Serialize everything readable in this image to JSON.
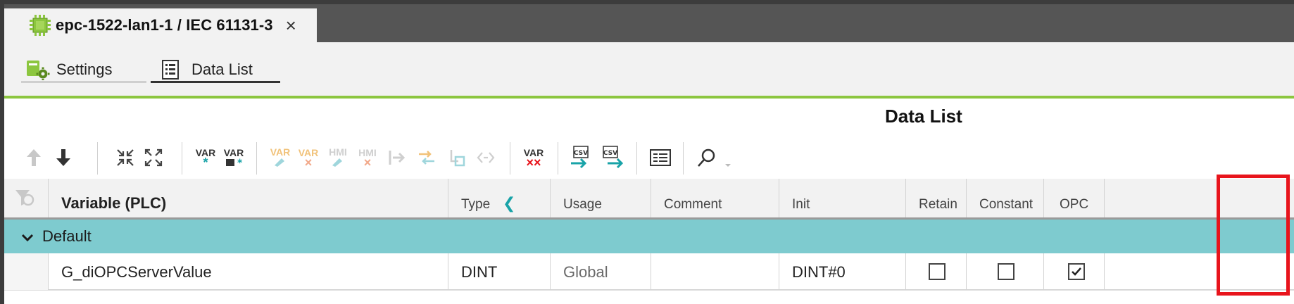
{
  "doc_tab": {
    "title": "epc-1522-lan1-1 / IEC 61131-3",
    "close": "×"
  },
  "subtabs": {
    "settings": "Settings",
    "data_list": "Data List"
  },
  "page_title": "Data List",
  "toolbar": {
    "var_label": "VAR",
    "hmi_label": "HMI",
    "csv_label": "CSV",
    "add_sub": "*",
    "delete_sub": "××"
  },
  "columns": {
    "variable": "Variable (PLC)",
    "type": "Type",
    "usage": "Usage",
    "comment": "Comment",
    "init": "Init",
    "retain": "Retain",
    "constant": "Constant",
    "opc": "OPC"
  },
  "group": {
    "label": "Default"
  },
  "rows": [
    {
      "variable": "G_diOPCServerValue",
      "type": "DINT",
      "usage": "Global",
      "comment": "",
      "init": "DINT#0",
      "retain": false,
      "constant": false,
      "opc": true
    }
  ],
  "colors": {
    "accent_green": "#8cc63f",
    "group_teal": "#7ecbcf",
    "highlight_red": "#e8141c",
    "icon_teal": "#19a3a8"
  }
}
